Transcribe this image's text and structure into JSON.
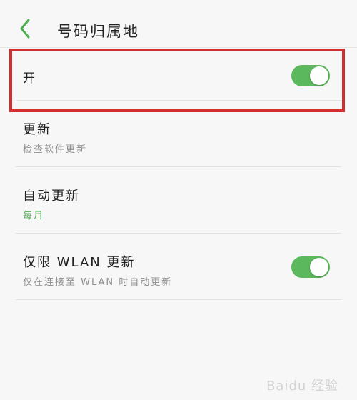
{
  "header": {
    "title": "号码归属地",
    "back_icon": "chevron-left-icon",
    "accent_color": "#4caf50"
  },
  "settings": {
    "main_switch": {
      "label": "开",
      "enabled": true
    },
    "update": {
      "title": "更新",
      "subtitle": "检查软件更新"
    },
    "auto_update": {
      "title": "自动更新",
      "value": "每月"
    },
    "wlan_only": {
      "title": "仅限 WLAN 更新",
      "subtitle": "仅在连接至 WLAN 时自动更新",
      "enabled": true
    }
  },
  "colors": {
    "toggle_on": "#5cb85c",
    "highlight": "#d32f2f"
  },
  "watermark": "Baidu 经验"
}
